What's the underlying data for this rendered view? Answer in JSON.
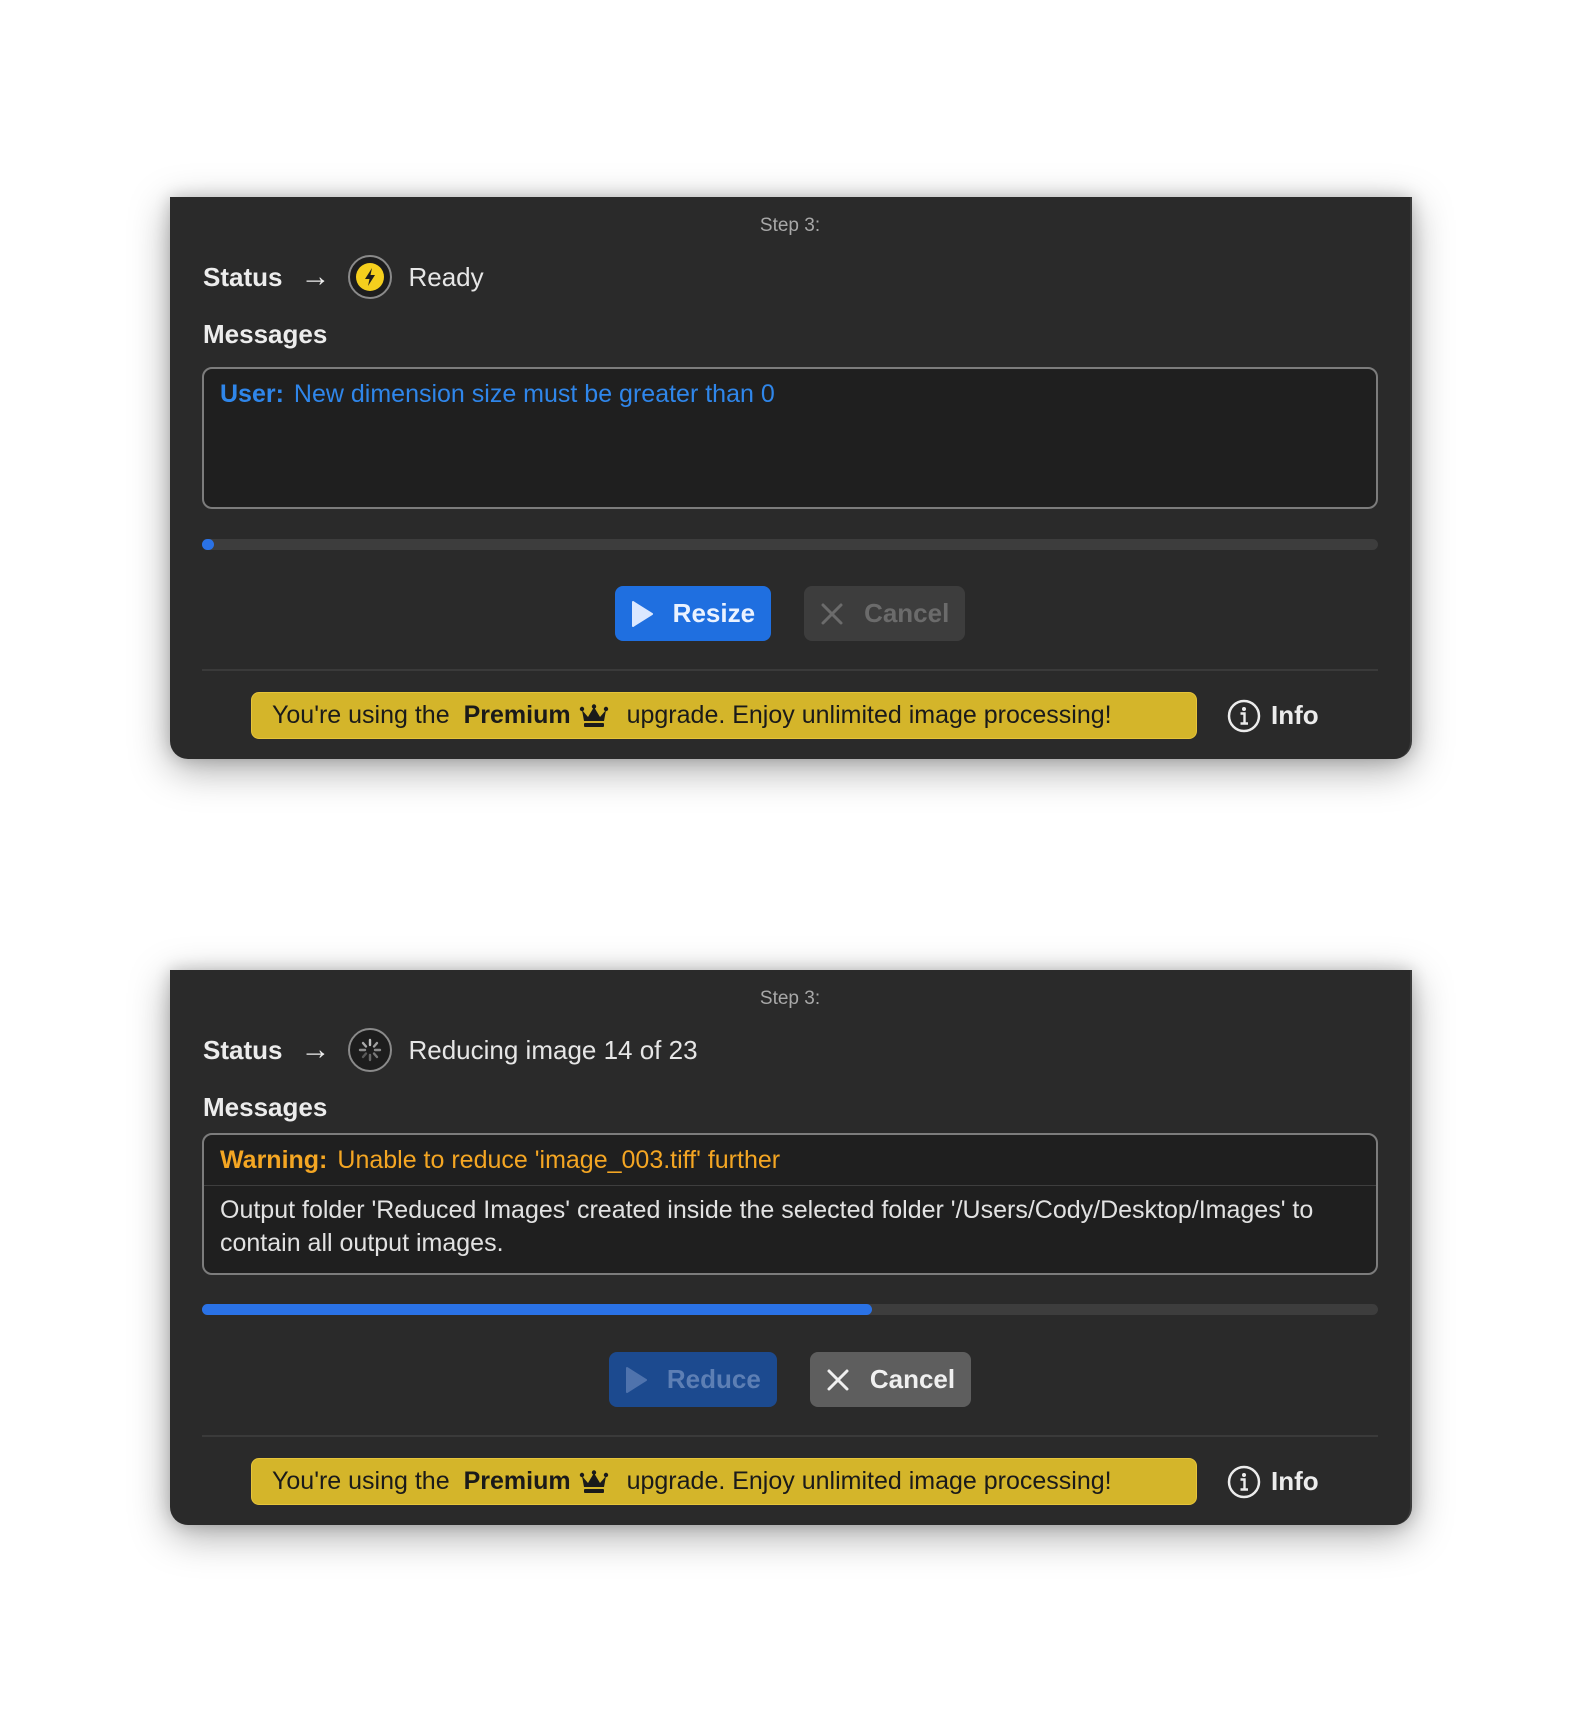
{
  "panels": [
    {
      "step_label": "Step 3:",
      "status_label": "Status",
      "status_arrow": "→",
      "status_icon": "bolt-icon",
      "status_text": "Ready",
      "messages_label": "Messages",
      "messages": [
        {
          "type": "user",
          "tag": "User:",
          "text": "New dimension size must be greater than 0",
          "color": "#2f86ea"
        }
      ],
      "progress": 0.005,
      "primary_button": {
        "label": "Resize",
        "icon": "play-icon",
        "enabled": true
      },
      "cancel_button": {
        "label": "Cancel",
        "icon": "close-icon",
        "enabled": false
      },
      "banner": {
        "prefix": "You're using the",
        "tier": "Premium",
        "tier_icon": "crown-icon",
        "suffix": "upgrade. Enjoy unlimited image processing!",
        "color": "#d4b52a"
      },
      "info_button": {
        "label": "Info",
        "icon": "info-circle-icon"
      }
    },
    {
      "step_label": "Step 3:",
      "status_label": "Status",
      "status_arrow": "→",
      "status_icon": "spinner-icon",
      "status_text": "Reducing image 14 of 23",
      "messages_label": "Messages",
      "messages": [
        {
          "type": "warning",
          "tag": "Warning:",
          "text": "Unable to reduce 'image_003.tiff' further",
          "color": "#f4a623"
        },
        {
          "type": "info",
          "text": "Output folder 'Reduced Images' created inside the selected folder '/Users/Cody/Desktop/Images' to contain all output images."
        }
      ],
      "progress": 0.57,
      "primary_button": {
        "label": "Reduce",
        "icon": "play-icon",
        "enabled": false
      },
      "cancel_button": {
        "label": "Cancel",
        "icon": "close-icon",
        "enabled": true
      },
      "banner": {
        "prefix": "You're using the",
        "tier": "Premium",
        "tier_icon": "crown-icon",
        "suffix": "upgrade. Enjoy unlimited image processing!",
        "color": "#d4b52a"
      },
      "info_button": {
        "label": "Info",
        "icon": "info-circle-icon"
      }
    }
  ],
  "colors": {
    "panel_bg": "#2a2a2a",
    "accent_blue": "#1f6fe0",
    "progress_blue": "#2a72e6",
    "warning_orange": "#f4a623",
    "status_yellow": "#f5cf1d"
  }
}
